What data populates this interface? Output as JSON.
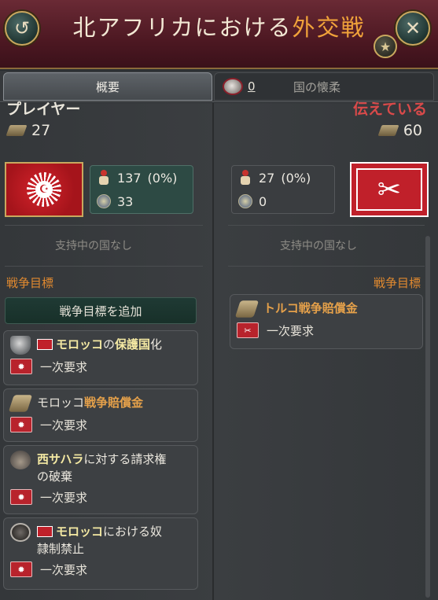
{
  "header": {
    "title_main": "北アフリカにおける",
    "title_highlight": "外交戦",
    "back_icon": "↺",
    "close_icon": "✕",
    "fav_icon": "★"
  },
  "tabs": {
    "overview_label": "概要",
    "infamy_count": "0",
    "infamy_label": "国の懐柔"
  },
  "left_side": {
    "name": "プレイヤー",
    "score": "27",
    "soldiers": "137",
    "soldiers_pct": "(0%)",
    "generals": "33",
    "no_support": "支持中の国なし",
    "goals_title": "戦争目標",
    "add_goal_label": "戦争目標を追加",
    "goals": [
      {
        "parts": [
          "",
          "モロッコ",
          "の",
          "保護国",
          "化"
        ],
        "demand": "一次要求"
      },
      {
        "parts": [
          "モロッコ",
          "戦争賠償金"
        ],
        "demand": "一次要求"
      },
      {
        "parts": [
          "西サハラ",
          "に対する請求権",
          "の破棄"
        ],
        "demand": "一次要求"
      },
      {
        "parts": [
          "モロッコ",
          "における奴",
          "隷制禁止"
        ],
        "demand": "一次要求"
      }
    ]
  },
  "right_side": {
    "name": "伝えている",
    "score": "60",
    "soldiers": "27",
    "soldiers_pct": "(0%)",
    "generals": "0",
    "no_support": "支持中の国なし",
    "goals_title": "戦争目標",
    "goals": [
      {
        "parts": [
          "トルコ",
          "戦争賠償金"
        ],
        "demand": "一次要求"
      }
    ]
  }
}
